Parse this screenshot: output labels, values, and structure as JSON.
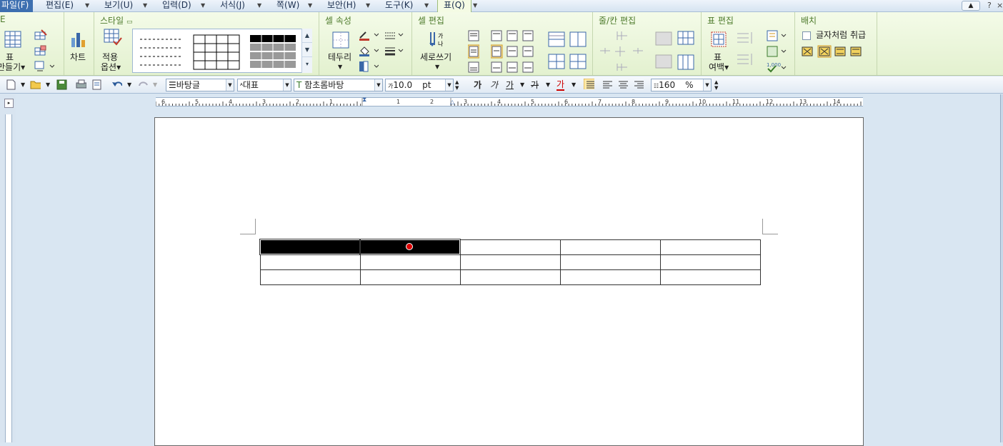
{
  "menubar": {
    "items": [
      {
        "label": "파일(F)",
        "state": "active"
      },
      {
        "label": "편집(E)"
      },
      {
        "label": "보기(U)"
      },
      {
        "label": "입력(D)"
      },
      {
        "label": "서식(J)"
      },
      {
        "label": "쪽(W)"
      },
      {
        "label": "보안(H)"
      },
      {
        "label": "도구(K)"
      },
      {
        "label": "표(Q)",
        "state": "tab"
      }
    ],
    "help": "?",
    "close": "×"
  },
  "ribbon": {
    "make_table": {
      "icon_label": "표",
      "label": "만들기▾"
    },
    "chart": {
      "label": "차트"
    },
    "style": {
      "title": "스타일",
      "apply_label1": "적용",
      "apply_label2": "옵션▾"
    },
    "cell_attr": {
      "title": "셀 속성",
      "border_label": "테두리"
    },
    "cell_edit": {
      "title": "셀 편집",
      "vertical_label": "세로쓰기"
    },
    "row_col_edit": {
      "title": "줄/칸 편집"
    },
    "table_edit": {
      "title": "표 편집",
      "margin_label1": "표",
      "margin_label2": "여백▾"
    },
    "arrange": {
      "title": "배치",
      "treat_as_char": "글자처럼 취급"
    }
  },
  "toolbar": {
    "style_combo": "바탕글",
    "lang_combo": "대표",
    "font_combo": "함초롬바탕",
    "size_value": "10.0",
    "size_unit": "pt",
    "bold": "가",
    "italic": "가",
    "underline": "가",
    "strike": "가",
    "color": "가",
    "line_spacing": "160",
    "line_spacing_unit": "%"
  },
  "hruler": {
    "numbers": [
      "6",
      "5",
      "4",
      "3",
      "2",
      "1",
      "",
      "1",
      "2",
      "3",
      "4",
      "5",
      "6",
      "7",
      "8",
      "9",
      "10",
      "11",
      "12",
      "13",
      "14"
    ]
  },
  "table": {
    "rows": 3,
    "cols": 5,
    "selected_cells": [
      [
        0,
        0
      ],
      [
        0,
        1
      ]
    ]
  },
  "colors": {
    "ribbon": "#e9f4da",
    "menu_active": "#3d6fb0",
    "group_title": "#4d7a2b",
    "selection": "#000000",
    "cursor": "#dd0000"
  }
}
